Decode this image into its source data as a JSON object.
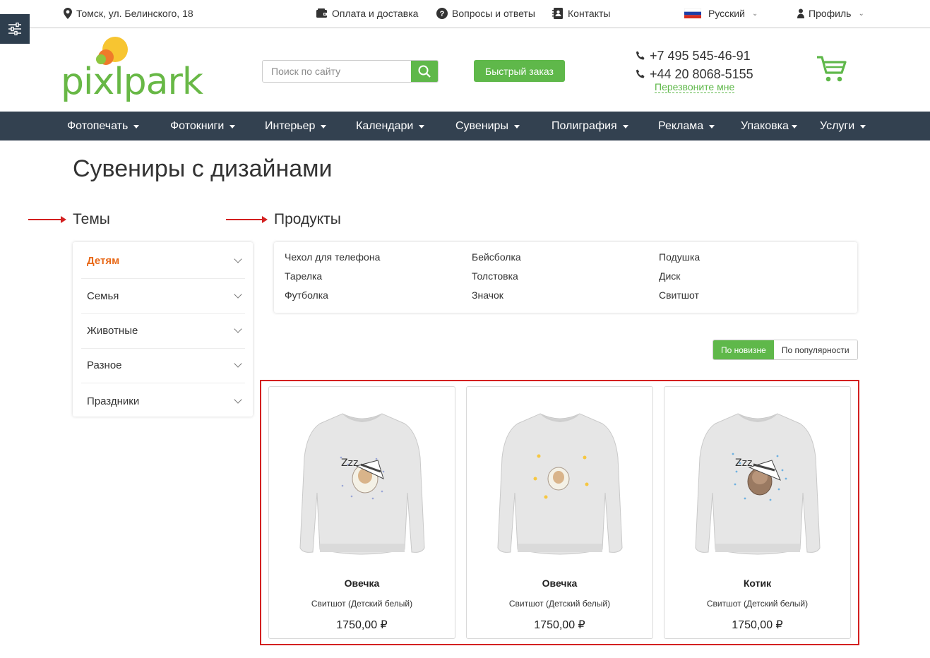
{
  "topbar": {
    "address": "Томск, ул. Белинского, 18",
    "payment": "Оплата и доставка",
    "faq": "Вопросы и ответы",
    "contacts": "Контакты",
    "language": "Русский",
    "profile": "Профиль"
  },
  "header": {
    "logo": "pixlpark",
    "search_placeholder": "Поиск по сайту",
    "quick_order": "Быстрый заказ",
    "phone1": "+7 495 545-46-91",
    "phone2": "+44 20 8068-5155",
    "callback": "Перезвоните мне"
  },
  "nav": [
    "Фотопечать",
    "Фотокниги",
    "Интерьер",
    "Календари",
    "Сувениры",
    "Полиграфия",
    "Реклама",
    "Упаковка",
    "Услуги"
  ],
  "page": {
    "title": "Сувениры с дизайнами",
    "themes_title": "Темы",
    "products_title": "Продукты"
  },
  "themes": [
    {
      "label": "Детям",
      "active": true
    },
    {
      "label": "Семья",
      "active": false
    },
    {
      "label": "Животные",
      "active": false
    },
    {
      "label": "Разное",
      "active": false
    },
    {
      "label": "Праздники",
      "active": false
    }
  ],
  "products": [
    [
      "Чехол для телефона",
      "Бейсболка",
      "Подушка"
    ],
    [
      "Тарелка",
      "Толстовка",
      "Диск"
    ],
    [
      "Футболка",
      "Значок",
      "Свитшот"
    ]
  ],
  "sort": {
    "newest": "По новизне",
    "popular": "По популярности"
  },
  "cards": [
    {
      "name": "Овечка",
      "subtitle": "Свитшот (Детский белый)",
      "price": "1750,00 ₽",
      "print": "sheep-sleep-cap"
    },
    {
      "name": "Овечка",
      "subtitle": "Свитшот (Детский белый)",
      "price": "1750,00 ₽",
      "print": "sheep-moon"
    },
    {
      "name": "Котик",
      "subtitle": "Свитшот (Детский белый)",
      "price": "1750,00 ₽",
      "print": "cat-sleep-cap"
    }
  ],
  "colors": {
    "accent": "#5fb84a",
    "nav": "#334150",
    "active_theme": "#e86a1a",
    "annotation": "#d32020"
  }
}
